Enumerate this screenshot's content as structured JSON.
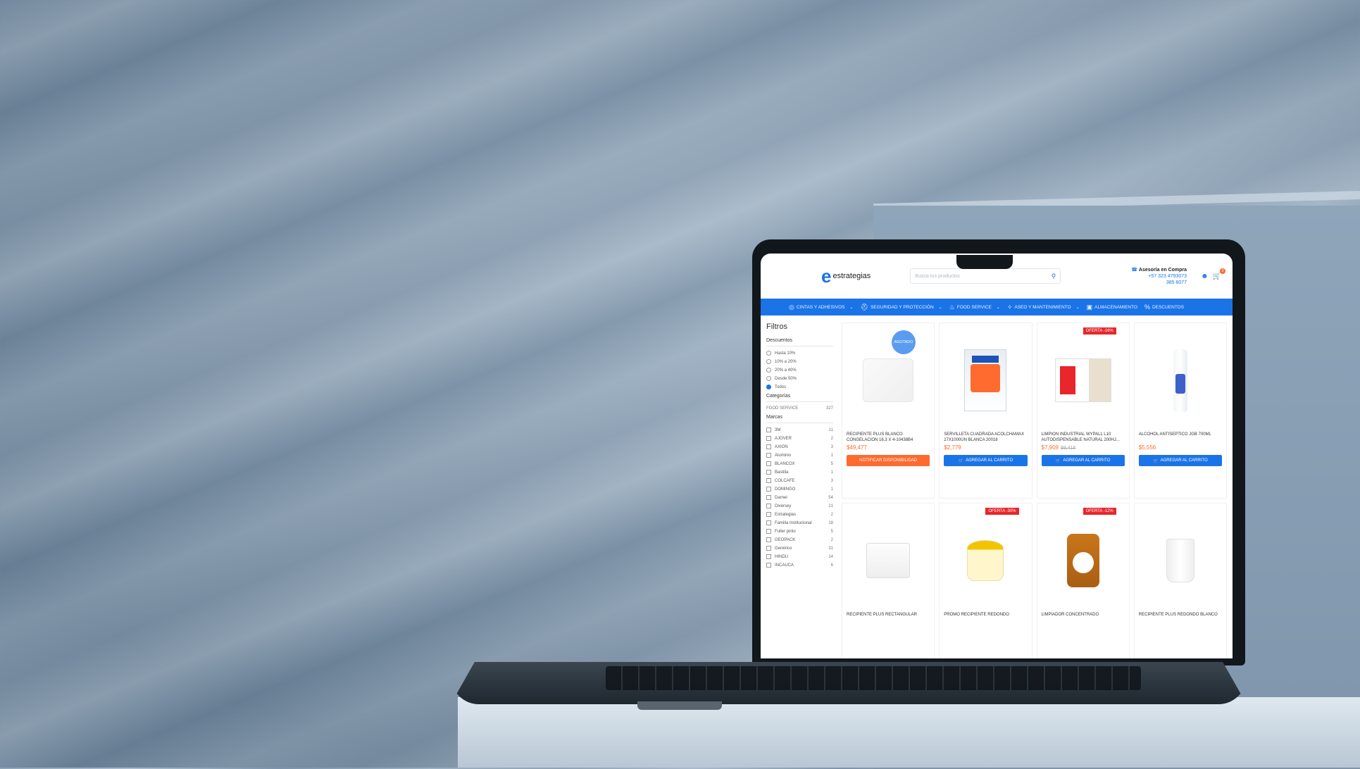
{
  "site": {
    "logo_text": "estrategias",
    "search_placeholder": "Busca tus productos",
    "contact_title": "Asesoría en Compra",
    "contact_phone": "+57 323 4793073",
    "contact_phone2": "385 8077",
    "cart_count": "0"
  },
  "nav": [
    {
      "label": "CINTAS Y ADHESIVOS",
      "icon": "tape-icon"
    },
    {
      "label": "SEGURIDAD Y PROTECCIÓN",
      "icon": "helmet-icon"
    },
    {
      "label": "FOOD SERVICE",
      "icon": "food-icon"
    },
    {
      "label": "ASEO Y MANTENIMIENTO",
      "icon": "cleaning-icon"
    },
    {
      "label": "ALMACENAMIENTO",
      "icon": "box-icon"
    },
    {
      "label": "DESCUENTOS",
      "icon": "discount-icon"
    }
  ],
  "filters": {
    "title": "Filtros",
    "discounts_title": "Descuentos",
    "discounts": [
      "Hasta 10%",
      "10% a 20%",
      "20% a 40%",
      "Desde 50%",
      "Todos"
    ],
    "categories_title": "Categorías",
    "categories": [
      {
        "name": "FOOD SERVICE",
        "count": "327"
      }
    ],
    "brands_title": "Marcas",
    "brands": [
      {
        "name": "3M",
        "count": "11"
      },
      {
        "name": "AJOVER",
        "count": "2"
      },
      {
        "name": "AXION",
        "count": "3"
      },
      {
        "name": "Aluminio",
        "count": "1"
      },
      {
        "name": "BLANCOX",
        "count": "5"
      },
      {
        "name": "Bastilla",
        "count": "1"
      },
      {
        "name": "COLCAFE",
        "count": "3"
      },
      {
        "name": "DOMINGO",
        "count": "1"
      },
      {
        "name": "Darnel",
        "count": "54"
      },
      {
        "name": "Diversey",
        "count": "21"
      },
      {
        "name": "Estrategias",
        "count": "2"
      },
      {
        "name": "Familia Institucional",
        "count": "18"
      },
      {
        "name": "Fuller pinto",
        "count": "5"
      },
      {
        "name": "GEOPACK",
        "count": "2"
      },
      {
        "name": "Genérico",
        "count": "31"
      },
      {
        "name": "HINDU",
        "count": "14"
      },
      {
        "name": "INCAUCA",
        "count": "6"
      }
    ]
  },
  "products": [
    {
      "name": "RECIPIENTE PLUS BLANCO CONGELACION 16,3 X 4-10438B4",
      "price": "$49,477",
      "old": "",
      "button": "NOTIFICAR DISPONIBILIDAD",
      "badge": "AGOTADO",
      "style": "orange",
      "img": "box-clear"
    },
    {
      "name": "SERVILLETA CUADRADA ACOLCHAMAX 27X1000Un BLANCA 20018",
      "price": "$2,779",
      "old": "",
      "button": "AGREGAR AL CARRITO",
      "badge": "",
      "style": "blue",
      "img": "napkin"
    },
    {
      "name": "LIMPION INDUSTRIAL WYPALL L10 AUTODISPENSABLE NATURAL 200HJ...",
      "price": "$7,909",
      "old": "$9,415",
      "button": "AGREGAR AL CARRITO",
      "badge": "OFERTA -16%",
      "style": "blue",
      "img": "wypall"
    },
    {
      "name": "ALCOHOL ANTISEPTICO JGB 700ml",
      "price": "$5,556",
      "old": "",
      "button": "AGREGAR AL CARRITO",
      "badge": "",
      "style": "blue",
      "img": "bottle"
    },
    {
      "name": "RECIPIENTE PLUS RECTANGULAR",
      "price": "",
      "old": "",
      "button": "",
      "badge": "",
      "style": "blue",
      "img": "tub"
    },
    {
      "name": "PROMO RECIPIENTE REDONDO",
      "price": "",
      "old": "",
      "button": "",
      "badge": "OFERTA -30%",
      "style": "blue",
      "img": "yellow-cup"
    },
    {
      "name": "LIMPIADOR CONCENTRADO",
      "price": "",
      "old": "",
      "button": "",
      "badge": "OFERTA -12%",
      "style": "blue",
      "img": "jug"
    },
    {
      "name": "RECIPIENTE PLUS REDONDO BLANCO",
      "price": "",
      "old": "",
      "button": "",
      "badge": "",
      "style": "blue",
      "img": "cup"
    }
  ],
  "colors": {
    "brand": "#1a74e8",
    "accent": "#ff6a2e",
    "sale": "#e8262b"
  }
}
